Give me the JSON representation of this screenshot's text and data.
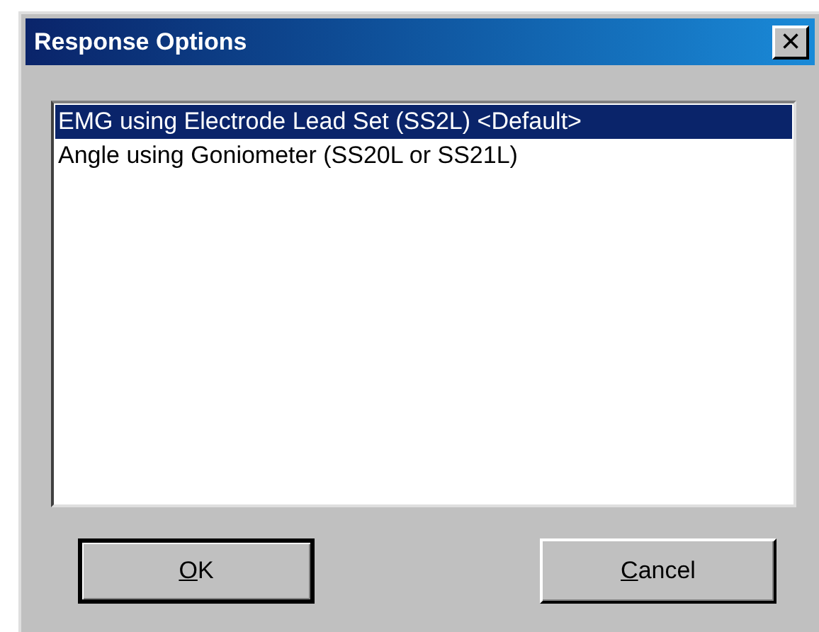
{
  "window": {
    "title": "Response Options",
    "close": "×"
  },
  "list": {
    "items": [
      {
        "label": "EMG using Electrode Lead Set (SS2L) <Default>",
        "selected": true
      },
      {
        "label": "Angle using Goniometer (SS20L or SS21L)",
        "selected": false
      }
    ]
  },
  "buttons": [
    {
      "label": "OK",
      "first_letter_underlined": true,
      "default": true
    },
    {
      "label": "Cancel",
      "first_letter_underlined": true,
      "default": false
    }
  ]
}
